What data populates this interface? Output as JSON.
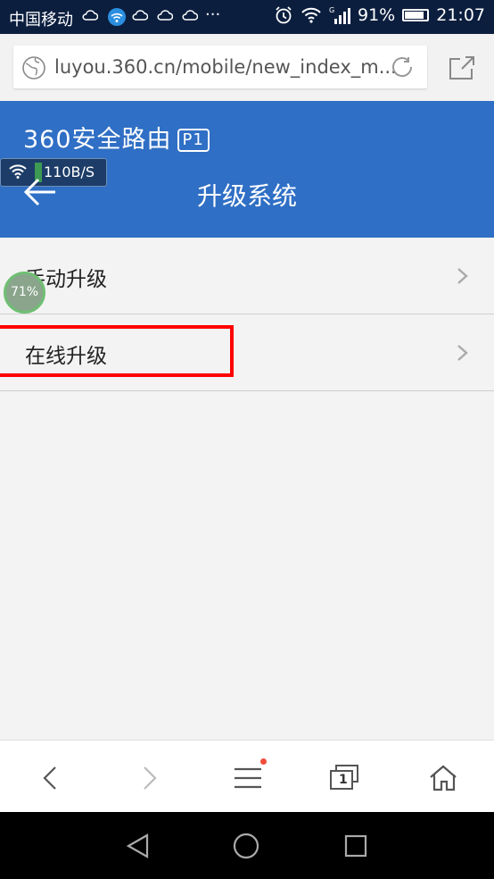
{
  "status_bar": {
    "carrier": "中国移动",
    "more": "···",
    "battery_percent": "91%",
    "battery_level": 0.91,
    "time": "21:07"
  },
  "browser": {
    "url": "luyou.360.cn/mobile/new_index_m..."
  },
  "header": {
    "brand": "360安全路由",
    "model": "P1",
    "page_title": "升级系统"
  },
  "speed_widget": {
    "speed": "110B/S"
  },
  "progress_bubble": {
    "text": "71%"
  },
  "menu": {
    "items": [
      {
        "label": "手动升级"
      },
      {
        "label": "在线升级"
      }
    ]
  },
  "bottom_nav": {
    "tab_count": "1"
  },
  "colors": {
    "header_bg": "#2f6fc5",
    "status_bg": "#0b1e3e",
    "highlight": "#ff0000",
    "menu_badge": "#f24b3a"
  }
}
